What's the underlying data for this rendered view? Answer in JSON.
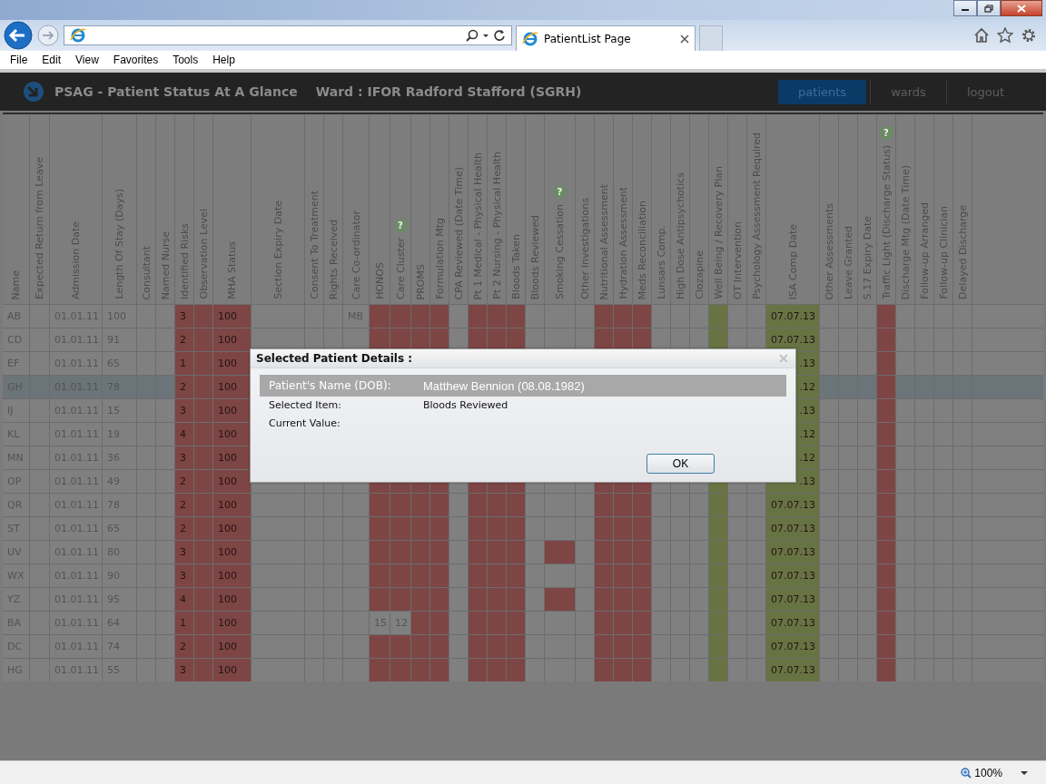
{
  "browser": {
    "tab": {
      "title": "PatientList Page",
      "selected": true
    },
    "menu": [
      "File",
      "Edit",
      "View",
      "Favorites",
      "Tools",
      "Help"
    ]
  },
  "app": {
    "title": "PSAG - Patient Status At A Glance",
    "ward": "Ward : IFOR Radford Stafford (SGRH)",
    "nav": [
      {
        "label": "patients",
        "selected": true
      },
      {
        "label": "wards",
        "selected": false
      },
      {
        "label": "logout",
        "selected": false
      }
    ]
  },
  "grid": {
    "columns": [
      {
        "label": "Name"
      },
      {
        "label": "Expected Return from Leave"
      },
      {
        "label": "Admission Date"
      },
      {
        "label": "Length Of Stay (Days)"
      },
      {
        "label": "Consultant"
      },
      {
        "label": "Named Nurse"
      },
      {
        "label": "Identified Risks",
        "color": "#7e4545"
      },
      {
        "label": "Observation Level",
        "color": "#7e4545"
      },
      {
        "label": "MHA Status",
        "color": "#7e4545"
      },
      {
        "label": "Section Expiry Date"
      },
      {
        "label": "Consent To Treatment"
      },
      {
        "label": "Rights Received"
      },
      {
        "label": "Care Co-ordinator"
      },
      {
        "label": "HONOS",
        "color": "#7e4545"
      },
      {
        "label": "Care Cluster",
        "color": "#7e4545",
        "help": "?"
      },
      {
        "label": "PROMS",
        "color": "#7e4545"
      },
      {
        "label": "Formulation Mtg",
        "color": "#7e4545"
      },
      {
        "label": "CPA Reviewed (Date Time)"
      },
      {
        "label": "Pt 1 Medical - Physical Health",
        "color": "#7e4545"
      },
      {
        "label": "Pt 2 Nursing - Physical Health",
        "color": "#7e4545"
      },
      {
        "label": "Bloods Taken",
        "color": "#7e4545"
      },
      {
        "label": "Bloods Reviewed"
      },
      {
        "label": "Smoking Cessation",
        "help": "?"
      },
      {
        "label": "Other Investigations"
      },
      {
        "label": "Nutritional Assessment",
        "color": "#7e4545"
      },
      {
        "label": "Hydration Assessment",
        "color": "#7e4545"
      },
      {
        "label": "Meds Reconciliation",
        "color": "#7e4545"
      },
      {
        "label": "Lunsars Comp."
      },
      {
        "label": "High Dose Antipsychotics"
      },
      {
        "label": "Clozapine"
      },
      {
        "label": "Well Being / Recovery Plan",
        "color": "#687343"
      },
      {
        "label": "OT Intervention"
      },
      {
        "label": "Psychology Assessment Required"
      },
      {
        "label": "ISA Comp Date",
        "color": "#687343"
      },
      {
        "label": "Other Assessments"
      },
      {
        "label": "Leave Granted"
      },
      {
        "label": "S.17 Expiry Date"
      },
      {
        "label": "Traffic Light (Discharge Status)",
        "color": "#7e4545",
        "help": "?"
      },
      {
        "label": "Discharge Mtg (Date Time)"
      },
      {
        "label": "Follow-up Arranged"
      },
      {
        "label": "Follow-up Clinician"
      },
      {
        "label": "Delayed Discharge"
      }
    ],
    "rows": [
      {
        "name": "AB",
        "admission_date": "01.01.11",
        "length_of_stay": "100",
        "identified_risks": "3",
        "mha_status": "100",
        "care_coordinator": "MB",
        "isa_comp_date": "07.07.13",
        "selected": false
      },
      {
        "name": "CD",
        "admission_date": "01.01.11",
        "length_of_stay": "91",
        "identified_risks": "2",
        "mha_status": "100",
        "isa_comp_date": "07.07.13",
        "selected": false
      },
      {
        "name": "EF",
        "admission_date": "01.01.11",
        "length_of_stay": "65",
        "identified_risks": "1",
        "mha_status": "100",
        "isa_comp_date": ".13",
        "isa_cut": true,
        "selected": false
      },
      {
        "name": "GH",
        "admission_date": "01.01.11",
        "length_of_stay": "78",
        "identified_risks": "2",
        "mha_status": "100",
        "isa_comp_date": ".12",
        "isa_cut": true,
        "selected": true
      },
      {
        "name": "IJ",
        "admission_date": "01.01.11",
        "length_of_stay": "15",
        "identified_risks": "3",
        "mha_status": "100",
        "isa_comp_date": ".13",
        "isa_cut": true,
        "selected": false
      },
      {
        "name": "KL",
        "admission_date": "01.01.11",
        "length_of_stay": "19",
        "identified_risks": "4",
        "mha_status": "100",
        "isa_comp_date": ".12",
        "isa_cut": true,
        "selected": false
      },
      {
        "name": "MN",
        "admission_date": "01.01.11",
        "length_of_stay": "36",
        "identified_risks": "3",
        "mha_status": "100",
        "isa_comp_date": ".12",
        "isa_cut": true,
        "selected": false
      },
      {
        "name": "OP",
        "admission_date": "01.01.11",
        "length_of_stay": "49",
        "identified_risks": "2",
        "mha_status": "100",
        "isa_comp_date": ".13",
        "isa_cut": true,
        "selected": false
      },
      {
        "name": "QR",
        "admission_date": "01.01.11",
        "length_of_stay": "78",
        "identified_risks": "2",
        "mha_status": "100",
        "isa_comp_date": "07.07.13",
        "selected": false
      },
      {
        "name": "ST",
        "admission_date": "01.01.11",
        "length_of_stay": "65",
        "identified_risks": "2",
        "mha_status": "100",
        "isa_comp_date": "07.07.13",
        "selected": false
      },
      {
        "name": "UV",
        "admission_date": "01.01.11",
        "length_of_stay": "80",
        "identified_risks": "3",
        "mha_status": "100",
        "smoking_cessation_flagged": true,
        "isa_comp_date": "07.07.13",
        "selected": false
      },
      {
        "name": "WX",
        "admission_date": "01.01.11",
        "length_of_stay": "90",
        "identified_risks": "3",
        "mha_status": "100",
        "isa_comp_date": "07.07.13",
        "selected": false
      },
      {
        "name": "YZ",
        "admission_date": "01.01.11",
        "length_of_stay": "95",
        "identified_risks": "4",
        "mha_status": "100",
        "smoking_cessation_flagged": true,
        "isa_comp_date": "07.07.13",
        "selected": false
      },
      {
        "name": "BA",
        "admission_date": "01.01.11",
        "length_of_stay": "64",
        "identified_risks": "1",
        "mha_status": "100",
        "honos": "15",
        "honos_colored": false,
        "care_cluster": "12",
        "care_cluster_colored": false,
        "isa_comp_date": "07.07.13",
        "selected": false
      },
      {
        "name": "DC",
        "admission_date": "01.01.11",
        "length_of_stay": "74",
        "identified_risks": "2",
        "mha_status": "100",
        "isa_comp_date": "07.07.13",
        "selected": false
      },
      {
        "name": "HG",
        "admission_date": "01.01.11",
        "length_of_stay": "55",
        "identified_risks": "3",
        "mha_status": "100",
        "isa_comp_date": "07.07.13",
        "selected": false
      }
    ]
  },
  "dialog": {
    "title": "Selected Patient Details :",
    "fields": [
      {
        "label": "Patient's Name (DOB):",
        "value": "Matthew Bennion (08.08.1982)",
        "highlighted": true
      },
      {
        "label": "Selected Item:",
        "value": "Bloods Reviewed",
        "highlighted": false
      },
      {
        "label": "Current Value:",
        "highlighted": false
      }
    ],
    "buttons": [
      "OK"
    ]
  },
  "status_bar": {
    "zoom": "100%"
  }
}
